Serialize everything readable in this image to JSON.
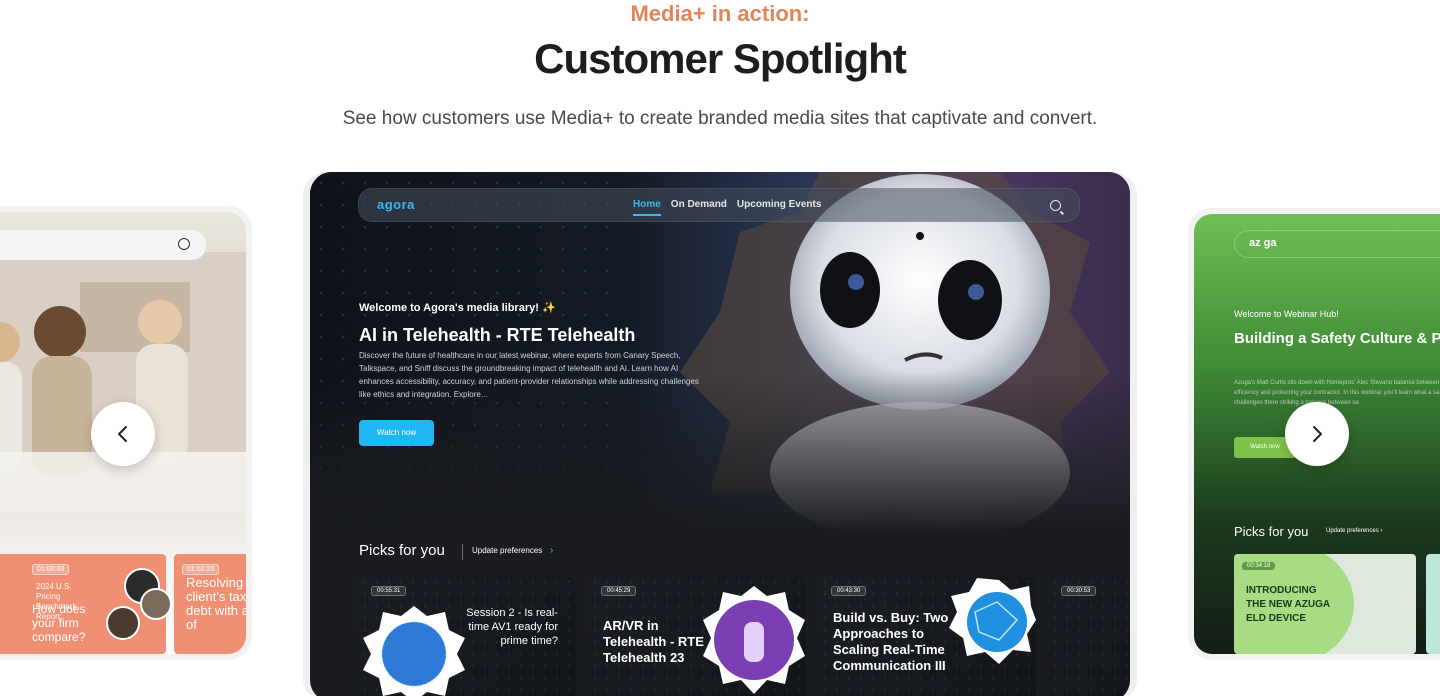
{
  "header": {
    "eyebrow": "Media+ in action:",
    "title": "Customer Spotlight",
    "subtitle": "See how customers use Media+ to create branded media sites that captivate and convert."
  },
  "colors": {
    "eyebrow": "#e0855a",
    "accent": "#1fb6f2",
    "green": "#7ec24c"
  },
  "carousel": {
    "prev_icon": "chevron-left-icon",
    "next_icon": "chevron-right-icon"
  },
  "left_card": {
    "search_icon": "search-icon",
    "tiles": [
      {
        "duration": "01:00:00",
        "subtitle": "2024 U.S. Pricing Benchmark Report:",
        "title": "How does your firm compare?"
      },
      {
        "duration": "01:02:20",
        "title": "Resolving the client's tax debt with an of"
      }
    ]
  },
  "main_card": {
    "brand": "agora",
    "nav": [
      "Home",
      "On Demand",
      "Upcoming Events"
    ],
    "search_icon": "search-icon",
    "welcome": "Welcome to Agora's media library! ✨",
    "hero_title": "AI in Telehealth - RTE Telehealth",
    "hero_desc": "Discover the future of healthcare in our latest webinar, where experts from Canary Speech, Talkspace, and Sniff discuss the groundbreaking impact of telehealth and AI. Learn how AI enhances accessibility, accuracy, and patient-provider relationships while addressing challenges like ethics and integration. Explore...",
    "cta": "Watch now",
    "picks_title": "Picks for you",
    "update_link": "Update preferences",
    "update_chevron": "›",
    "tiles": [
      {
        "duration": "00:55:31",
        "title": "Session 2 - Is real-time AV1 ready for prime time?"
      },
      {
        "duration": "00:45:29",
        "title": "AR/VR in Telehealth - RTE Telehealth 23"
      },
      {
        "duration": "00:43:30",
        "title": "Build vs. Buy: Two Approaches to Scaling Real-Time Communication III"
      },
      {
        "duration": "00:30:53",
        "title": ""
      }
    ]
  },
  "right_card": {
    "brand": "az ga",
    "welcome": "Welcome to Webinar Hub!",
    "title": "Building a Safety Culture & Pr Your Fleet",
    "desc": "Azuga's Matt Curtis sits down with Homepros' Alec Stevano balance between safety and efficiency and protecting your contractor. In this webinar you'll learn what a safety culture challenges there striking a balance between sa",
    "cta": "Watch now",
    "picks_title": "Picks for you",
    "update_link": "Update preferences ›",
    "tiles": [
      {
        "duration": "00:34:18",
        "title": "INTRODUCING THE NEW AZUGA ELD DEVICE"
      }
    ]
  }
}
